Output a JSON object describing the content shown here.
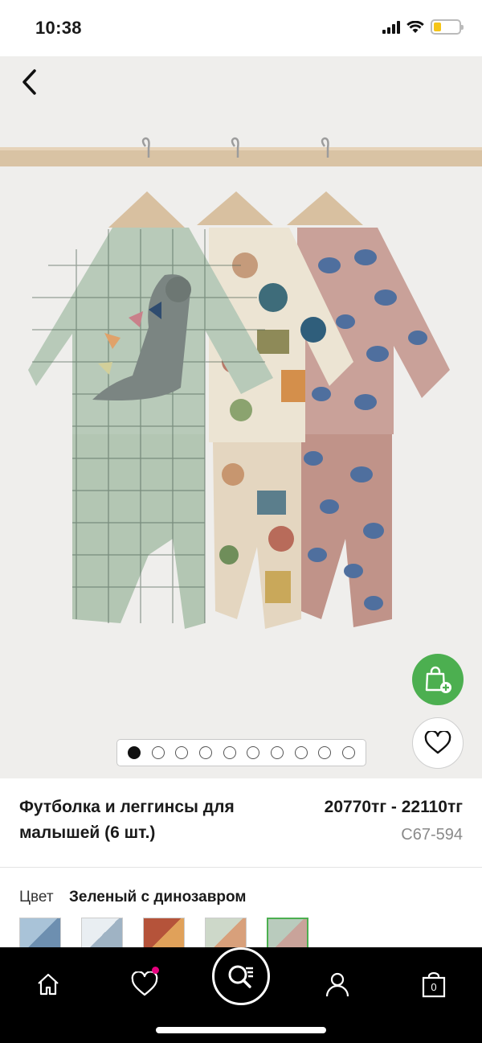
{
  "status_bar": {
    "time": "10:38",
    "battery_level": 0.3
  },
  "product": {
    "title": "Футболка и леггинсы для малышей (6 шт.)",
    "price": "20770тг - 22110тг",
    "sku": "C67-594"
  },
  "gallery": {
    "image_count": 10,
    "active_index": 0
  },
  "color": {
    "label": "Цвет",
    "value": "Зеленый с динозавром"
  },
  "swatches": [
    {
      "name": "blue-print",
      "colors": [
        "#a9c3d8",
        "#6d8fb0"
      ]
    },
    {
      "name": "white-print",
      "colors": [
        "#e9eef2",
        "#9fb3c4"
      ]
    },
    {
      "name": "rust-print",
      "colors": [
        "#b5533a",
        "#e0a15a"
      ]
    },
    {
      "name": "stripe",
      "colors": [
        "#cdd8c9",
        "#d8a07b"
      ]
    },
    {
      "name": "green-dino",
      "colors": [
        "#b9cbbd",
        "#c9a39a"
      ]
    }
  ],
  "nav": {
    "home": "home-icon",
    "favorites": "heart-icon",
    "search": "search-list-icon",
    "account": "user-icon",
    "bag_count": "0"
  },
  "colors": {
    "accent_green": "#4caf50",
    "badge_pink": "#e6007e"
  }
}
